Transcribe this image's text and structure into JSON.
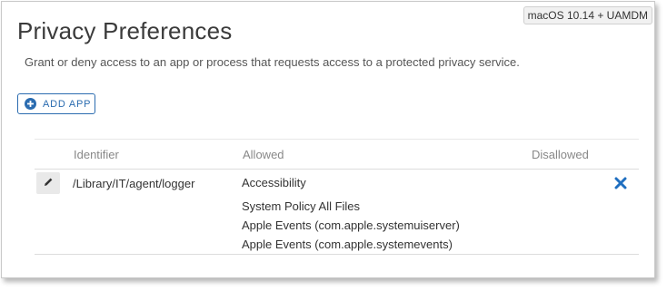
{
  "badge": "macOS 10.14 + UAMDM",
  "title": "Privacy Preferences",
  "description": "Grant or deny access to an app or process that requests access to a protected privacy service.",
  "add_app_label": "ADD APP",
  "table": {
    "headers": {
      "identifier": "Identifier",
      "allowed": "Allowed",
      "disallowed": "Disallowed"
    },
    "rows": [
      {
        "identifier": "/Library/IT/agent/logger",
        "allowed": [
          "Accessibility",
          "System Policy All Files",
          "Apple Events (com.apple.systemuiserver)",
          "Apple Events (com.apple.systemevents)"
        ]
      }
    ]
  },
  "colors": {
    "accent": "#2b6cb0",
    "title": "#3b3b3b",
    "muted": "#888888"
  },
  "icons": {
    "add": "plus-circle-icon",
    "edit": "pencil-icon",
    "remove": "close-x-icon"
  }
}
